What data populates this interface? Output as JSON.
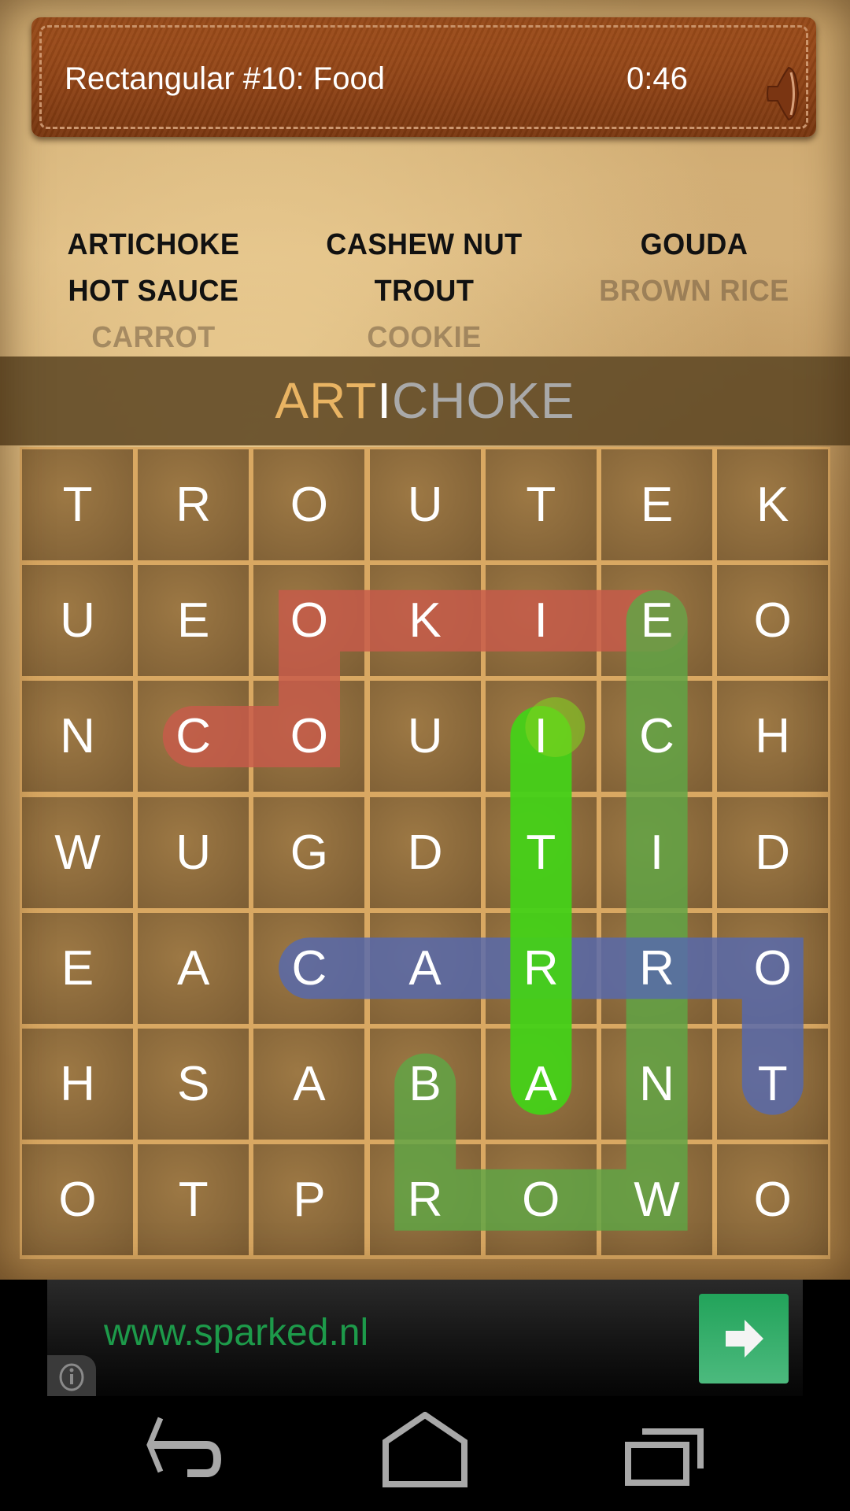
{
  "header": {
    "title": "Rectangular #10: Food",
    "timer": "0:46",
    "sound_icon": "speaker-icon"
  },
  "word_list": [
    {
      "word": "ARTICHOKE",
      "found": false
    },
    {
      "word": "CASHEW NUT",
      "found": false
    },
    {
      "word": "GOUDA",
      "found": false
    },
    {
      "word": "HOT SAUCE",
      "found": false
    },
    {
      "word": "TROUT",
      "found": false
    },
    {
      "word": "BROWN RICE",
      "found": true
    },
    {
      "word": "CARROT",
      "found": true
    },
    {
      "word": "COOKIE",
      "found": true
    }
  ],
  "current_word": {
    "full": "ARTICHOKE",
    "done": "ART",
    "current": "I",
    "rest": "CHOKE"
  },
  "grid": {
    "rows": [
      [
        "T",
        "R",
        "O",
        "U",
        "T",
        "E",
        "K"
      ],
      [
        "U",
        "E",
        "O",
        "K",
        "I",
        "E",
        "O"
      ],
      [
        "N",
        "C",
        "O",
        "U",
        "I",
        "C",
        "H"
      ],
      [
        "W",
        "U",
        "G",
        "D",
        "T",
        "I",
        "D"
      ],
      [
        "E",
        "A",
        "C",
        "A",
        "R",
        "R",
        "O"
      ],
      [
        "H",
        "S",
        "A",
        "B",
        "A",
        "N",
        "T"
      ],
      [
        "O",
        "T",
        "P",
        "R",
        "O",
        "W",
        "O"
      ]
    ]
  },
  "found_paths": [
    {
      "word": "COOKIE",
      "color": "#c85a4a",
      "cells": [
        [
          2,
          1
        ],
        [
          2,
          2
        ],
        [
          1,
          2
        ],
        [
          1,
          3
        ],
        [
          1,
          4
        ],
        [
          1,
          5
        ]
      ]
    },
    {
      "word": "BROWN RICE",
      "color": "#5fa646",
      "cells": [
        [
          5,
          3
        ],
        [
          6,
          3
        ],
        [
          6,
          4
        ],
        [
          6,
          5
        ],
        [
          5,
          5
        ],
        [
          4,
          5
        ],
        [
          3,
          5
        ],
        [
          2,
          5
        ],
        [
          1,
          5
        ]
      ]
    },
    {
      "word": "CARROT",
      "color": "#5569b0",
      "cells": [
        [
          4,
          2
        ],
        [
          4,
          3
        ],
        [
          4,
          4
        ],
        [
          4,
          5
        ],
        [
          4,
          6
        ],
        [
          5,
          6
        ]
      ]
    }
  ],
  "selection_path": {
    "color": "#45d118",
    "cursor_color": "#80d020",
    "cells": [
      [
        5,
        4
      ],
      [
        4,
        4
      ],
      [
        3,
        4
      ],
      [
        2,
        4
      ]
    ]
  },
  "ad": {
    "text": "www.sparked.nl",
    "button_icon": "arrow-right-icon",
    "info_icon": "info-icon"
  },
  "navbar": {
    "back": "back-icon",
    "home": "home-icon",
    "recents": "recents-icon"
  }
}
